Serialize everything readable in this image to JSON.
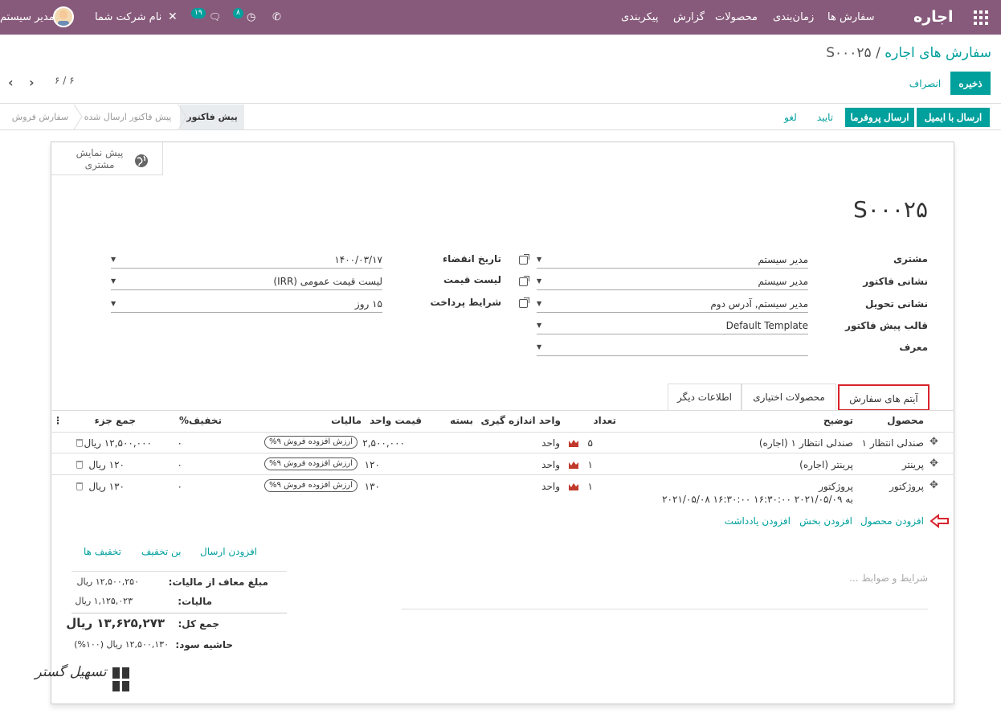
{
  "navbar": {
    "brand": "اجاره",
    "menu": [
      "سفارش ها",
      "زمان‌بندی",
      "محصولات",
      "گزارش",
      "پیکربندی"
    ],
    "user": "مدیر سیستم",
    "company": "نام شرکت شما",
    "messages_count": "۱۹",
    "activities_count": "۸"
  },
  "breadcrumb": {
    "parent": "سفارش های اجاره",
    "separator": "/",
    "current": "S۰۰۰۲۵"
  },
  "controls": {
    "save": "ذخیره",
    "discard": "انصراف",
    "pager": "۶ / ۶"
  },
  "statusbar": {
    "buttons": {
      "send_email": "ارسال با ایمیل",
      "send_proforma": "ارسال پروفرما",
      "confirm": "تایید",
      "cancel": "لغو"
    },
    "steps": [
      "پیش فاکتور",
      "پیش فاکتور ارسال شده",
      "سفارش فروش"
    ]
  },
  "smart_button": {
    "label_line1": "پیش نمایش",
    "label_line2": "مشتری",
    "icon": "globe-icon"
  },
  "order": {
    "name": "S۰۰۰۲۵"
  },
  "fields_right": [
    {
      "label": "مشتری",
      "value": "مدیر سیستم"
    },
    {
      "label": "نشانی فاکتور",
      "value": "مدیر سیستم"
    },
    {
      "label": "نشانی تحویل",
      "value": "مدیر سیستم, آدرس دوم"
    },
    {
      "label": "قالب پیش فاکتور",
      "value": "Default Template"
    },
    {
      "label": "معرف",
      "value": ""
    }
  ],
  "fields_left": [
    {
      "label": "تاریخ انقضاء",
      "value": "۱۴۰۰/۰۳/۱۷"
    },
    {
      "label": "لیست قیمت",
      "value": "لیست قیمت عمومی (IRR)"
    },
    {
      "label": "شرایط پرداخت",
      "value": "۱۵ روز"
    }
  ],
  "tabs": [
    "آیتم های سفارش",
    "محصولات اختیاری",
    "اطلاعات دیگر"
  ],
  "columns": {
    "product": "محصول",
    "description": "توضیح",
    "qty": "تعداد",
    "uom": "واحد اندازه گیری",
    "package": "بسته",
    "price": "قیمت واحد",
    "taxes": "مالیات",
    "discount": "تخفیف%",
    "subtotal": "جمع جزء"
  },
  "lines": [
    {
      "product": "صندلی انتظار ۱",
      "description": "صندلی انتظار ۱ (اجاره)",
      "qty": "۵",
      "uom": "واحد",
      "price": "۲,۵۰۰,۰۰۰",
      "tax": "ارزش افزوده فروش ۹%",
      "discount": "۰",
      "subtotal": "۱۲,۵۰۰,۰۰۰ ریال"
    },
    {
      "product": "پرینتر",
      "description": "پرینتر (اجاره)",
      "qty": "۱",
      "uom": "واحد",
      "price": "۱۲۰",
      "tax": "ارزش افزوده فروش ۹%",
      "discount": "۰",
      "subtotal": "۱۲۰ ریال"
    },
    {
      "product": "پروژکتور",
      "description": "پروژکتور",
      "description2": "۲۰۲۱/۰۵/۰۸ ۱۶:۳۰:۰۰ به ۲۰۲۱/۰۵/۰۹ ۱۶:۳۰:۰۰",
      "qty": "۱",
      "uom": "واحد",
      "price": "۱۳۰",
      "tax": "ارزش افزوده فروش ۹%",
      "discount": "۰",
      "subtotal": "۱۳۰ ریال"
    }
  ],
  "add_links": {
    "product": "افزودن محصول",
    "section": "افزودن بخش",
    "note": "افزودن یادداشت"
  },
  "action_links": {
    "shipping": "افزودن ارسال",
    "coupon": "بن تخفیف",
    "discounts": "تخفیف ها"
  },
  "terms_placeholder": "شرایط و ضوابط ...",
  "totals": [
    {
      "label": "مبلغ معاف از مالیات:",
      "value": "۱۲,۵۰۰,۲۵۰ ریال"
    },
    {
      "label": "مالیات:",
      "value": "۱,۱۲۵,۰۲۳ ریال"
    },
    {
      "label": "جمع کل:",
      "value": "۱۳,۶۲۵,۲۷۳ ریال"
    },
    {
      "label": "حاشیه سود:",
      "value": "۱۲,۵۰۰,۱۳۰ ریال (۱۰۰%)"
    }
  ],
  "watermark": "تسهیل گستر",
  "colors": {
    "navbar": "#875a7b",
    "accent": "#00a09d",
    "highlight": "#d9232d"
  }
}
